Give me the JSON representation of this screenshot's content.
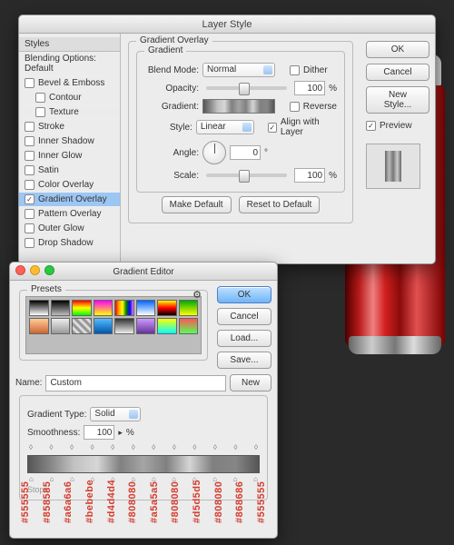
{
  "layerStyle": {
    "title": "Layer Style",
    "stylesHeader": "Styles",
    "blendingOptions": "Blending Options: Default",
    "effects": [
      "Bevel & Emboss",
      "Contour",
      "Texture",
      "Stroke",
      "Inner Shadow",
      "Inner Glow",
      "Satin",
      "Color Overlay",
      "Gradient Overlay",
      "Pattern Overlay",
      "Outer Glow",
      "Drop Shadow"
    ],
    "selectedEffect": "Gradient Overlay",
    "groupTitle": "Gradient Overlay",
    "subGroup": "Gradient",
    "labels": {
      "blendMode": "Blend Mode:",
      "opacity": "Opacity:",
      "gradient": "Gradient:",
      "style": "Style:",
      "angle": "Angle:",
      "scale": "Scale:"
    },
    "values": {
      "blendMode": "Normal",
      "opacity": "100",
      "pct": "%",
      "style": "Linear",
      "angle": "0",
      "angleDeg": "°",
      "scale": "100"
    },
    "checks": {
      "dither": "Dither",
      "reverse": "Reverse",
      "align": "Align with Layer"
    },
    "buttons": {
      "makeDefault": "Make Default",
      "reset": "Reset to Default",
      "ok": "OK",
      "cancel": "Cancel",
      "newStyle": "New Style...",
      "preview": "Preview"
    }
  },
  "gradientEditor": {
    "title": "Gradient Editor",
    "presets": "Presets",
    "gear": "⚙",
    "buttons": {
      "ok": "OK",
      "cancel": "Cancel",
      "load": "Load...",
      "save": "Save...",
      "new": "New"
    },
    "nameLabel": "Name:",
    "name": "Custom",
    "gradientTypeLabel": "Gradient Type:",
    "gradientType": "Solid",
    "smoothnessLabel": "Smoothness:",
    "smoothness": "100",
    "pct": "%",
    "stopsLabel": "Stops",
    "hexes": [
      "#555555",
      "#858585",
      "#a6a6a6",
      "#bebebe",
      "#d4d4d4",
      "#808080",
      "#a5a5a5",
      "#808080",
      "#d5d5d5",
      "#808080",
      "#868686",
      "#555555"
    ],
    "hexColors": [
      "#d43c2e",
      "#d43c2e",
      "#d43c2e",
      "#d43c2e",
      "#d43c2e",
      "#d43c2e",
      "#d43c2e",
      "#d43c2e",
      "#d43c2e",
      "#d43c2e",
      "#d43c2e",
      "#d43c2e"
    ]
  }
}
